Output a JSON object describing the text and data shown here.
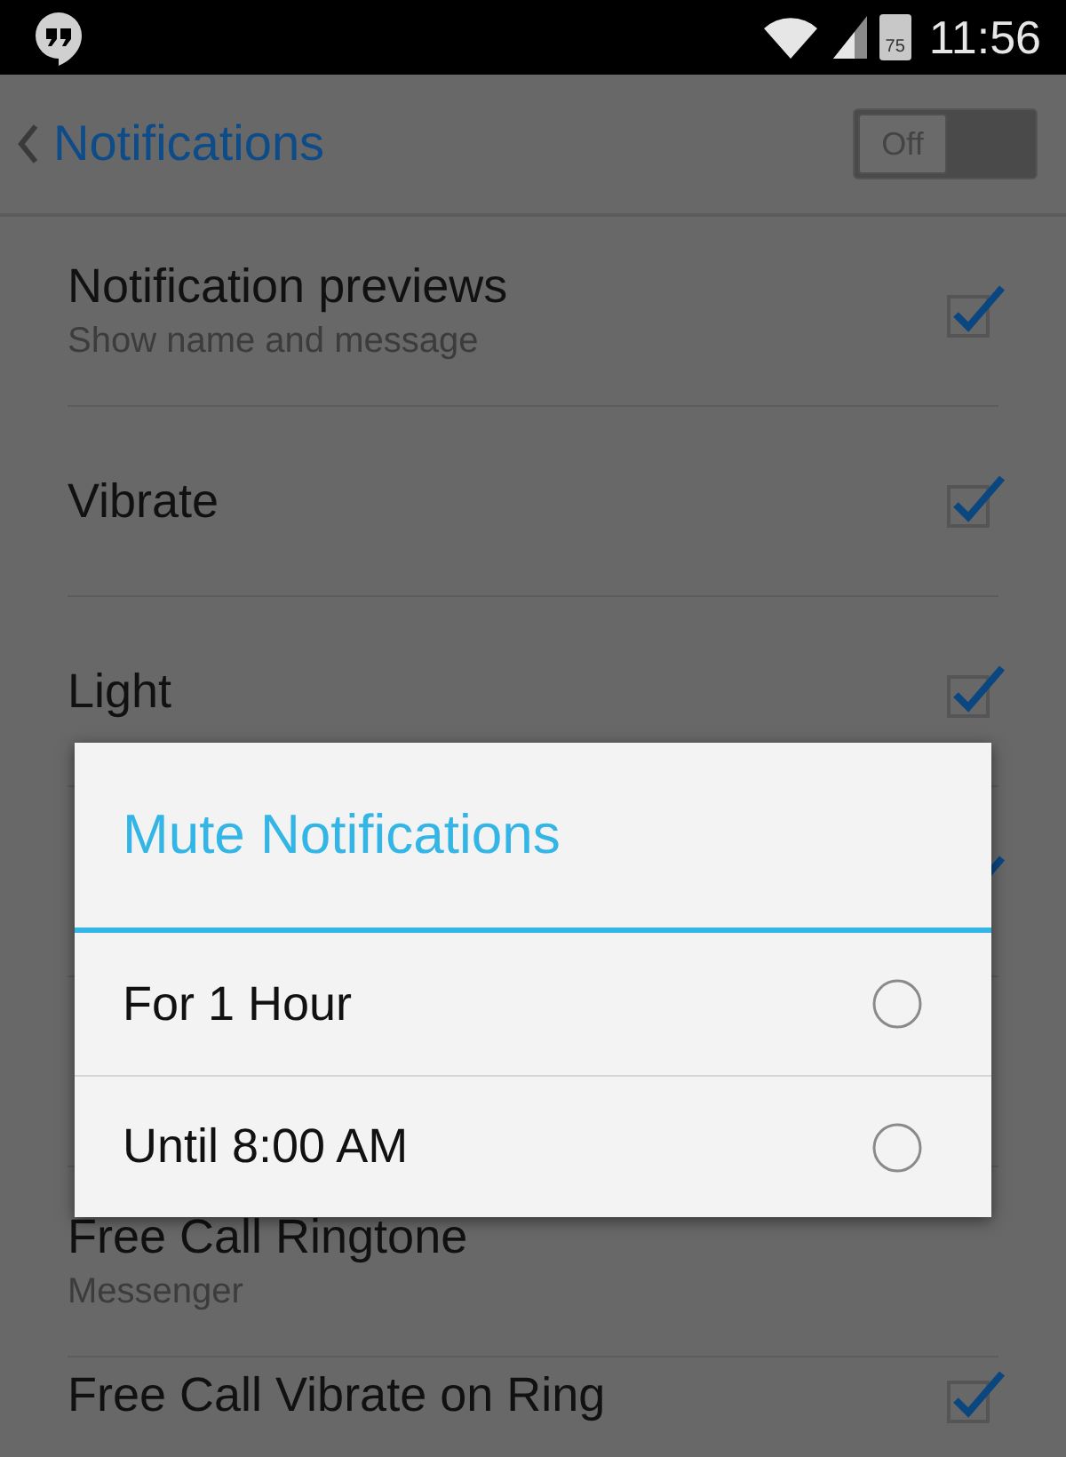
{
  "status_bar": {
    "battery": "75",
    "time": "11:56"
  },
  "action_bar": {
    "title": "Notifications",
    "toggle": {
      "label": "Off",
      "on": false
    }
  },
  "settings": [
    {
      "title": "Notification previews",
      "subtitle": "Show name and message",
      "checked": true
    },
    {
      "title": "Vibrate",
      "checked": true
    },
    {
      "title": "Light",
      "checked": true
    },
    {
      "checked": true
    },
    {
      "title": "Free Call Ringtone",
      "subtitle": "Messenger"
    },
    {
      "title": "Free Call Vibrate on Ring",
      "checked": true
    }
  ],
  "dialog": {
    "title": "Mute Notifications",
    "options": [
      {
        "label": "For 1 Hour",
        "selected": false
      },
      {
        "label": "Until 8:00 AM",
        "selected": false
      }
    ]
  }
}
